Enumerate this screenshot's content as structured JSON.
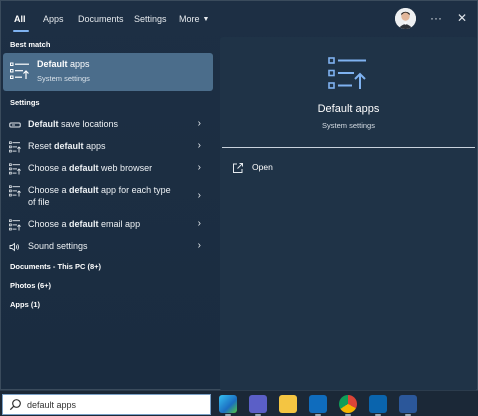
{
  "tabs": [
    {
      "label": "All",
      "active": true
    },
    {
      "label": "Apps"
    },
    {
      "label": "Documents"
    },
    {
      "label": "Settings"
    },
    {
      "label": "More"
    }
  ],
  "icons": {
    "more_options": "···",
    "close": "✕",
    "more_chevron": "▼",
    "row_chevron": "›"
  },
  "best_match": {
    "header": "Best match",
    "title_bold": "Default",
    "title_rest": " apps",
    "subtitle": "System settings"
  },
  "settings": {
    "header": "Settings",
    "items": [
      {
        "icon": "drive-icon",
        "pre": "",
        "bold": "Default",
        "post": " save locations"
      },
      {
        "icon": "list-icon",
        "pre": "Reset ",
        "bold": "default",
        "post": " apps"
      },
      {
        "icon": "list-icon",
        "pre": "Choose a ",
        "bold": "default",
        "post": " web browser"
      },
      {
        "icon": "list-icon",
        "pre": "Choose a ",
        "bold": "default",
        "post": " app for each type",
        "line2": "of file"
      },
      {
        "icon": "list-icon",
        "pre": "Choose a ",
        "bold": "default",
        "post": " email app"
      },
      {
        "icon": "speaker-icon",
        "pre": "Sound settings",
        "bold": "",
        "post": ""
      }
    ]
  },
  "categories": [
    {
      "label": "Documents - This PC (8+)"
    },
    {
      "label": "Photos (6+)"
    },
    {
      "label": "Apps (1)"
    }
  ],
  "detail": {
    "title": "Default apps",
    "subtitle": "System settings",
    "open_label": "Open"
  },
  "search": {
    "typed": "default apps",
    "placeholder": ""
  },
  "taskbar": {
    "apps": [
      {
        "name": "edge-icon",
        "color": "#1fa4d8"
      },
      {
        "name": "teams-icon",
        "color": "#5b5fc7"
      },
      {
        "name": "file-explorer-icon",
        "color": "#f4c542"
      },
      {
        "name": "outlook-icon",
        "color": "#0f6cbd"
      },
      {
        "name": "chrome-icon",
        "color": "#db4437"
      },
      {
        "name": "outlook-alt-icon",
        "color": "#0a64ad"
      },
      {
        "name": "word-icon",
        "color": "#2b579a"
      }
    ]
  },
  "colors": {
    "panel_bg": "#1d2f44",
    "selected_bg": "#4b6d8b",
    "accent": "#7fb2f0"
  }
}
